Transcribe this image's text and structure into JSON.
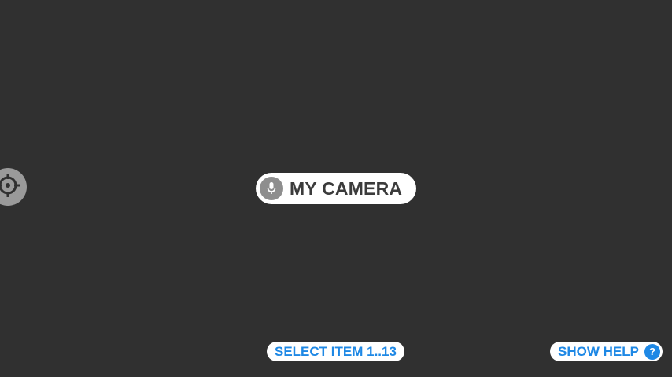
{
  "theme": {
    "background": "#303030",
    "accent": "#1e88e5",
    "pill_background": "#ffffff",
    "icon_gray": "#8e8e8e"
  },
  "voice_command": {
    "icon": "mic-icon",
    "label": "MY CAMERA"
  },
  "target": {
    "icon": "crosshair-icon"
  },
  "hints": {
    "select_item": "SELECT ITEM 1..13",
    "show_help": "SHOW HELP",
    "help_badge": "?"
  }
}
